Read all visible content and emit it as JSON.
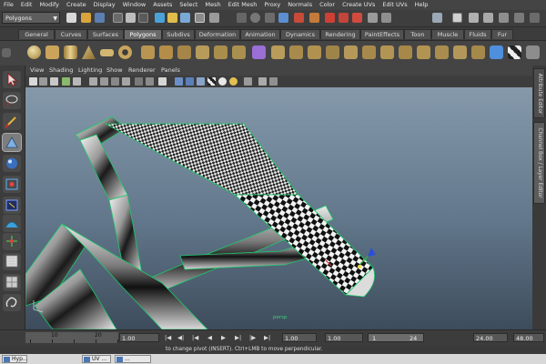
{
  "menubar": {
    "items": [
      "File",
      "Edit",
      "Modify",
      "Create",
      "Display",
      "Window",
      "Assets",
      "Select",
      "Mesh",
      "Edit Mesh",
      "Proxy",
      "Normals",
      "Color",
      "Create UVs",
      "Edit UVs",
      "Help"
    ]
  },
  "statusline": {
    "mode": "Polygons"
  },
  "shelf": {
    "tabs": [
      "General",
      "Curves",
      "Surfaces",
      "Polygons",
      "Subdivs",
      "Deformation",
      "Animation",
      "Dynamics",
      "Rendering",
      "PaintEffects",
      "Toon",
      "Muscle",
      "Fluids",
      "Fur"
    ],
    "active_tab": "Polygons"
  },
  "viewport": {
    "menu": [
      "View",
      "Shading",
      "Lighting",
      "Show",
      "Renderer",
      "Panels"
    ],
    "camera_label": "persp"
  },
  "side_tabs": [
    "Attribute Editor",
    "Channel Box / Layer Editor"
  ],
  "timeslider": {
    "ticks": [
      "10",
      "20"
    ],
    "start_range": "1.00",
    "start_time": "1.00",
    "end_time_field": "1.00",
    "current_frame": "1",
    "range_end": "24",
    "end_time": "24.00",
    "max_time": "48.00"
  },
  "helpline": {
    "text": "to change pivot (INSERT). Ctrl+LMB to move perpendicular."
  },
  "taskbar": {
    "items": [
      "Hyp...",
      "UV ...",
      "..."
    ]
  },
  "colors": {
    "accent_active_tab": "#6a6a6a",
    "wireframe_green": "#3ed07a",
    "viewport_top": "#8599ab",
    "viewport_bottom": "#3d4c5c"
  }
}
